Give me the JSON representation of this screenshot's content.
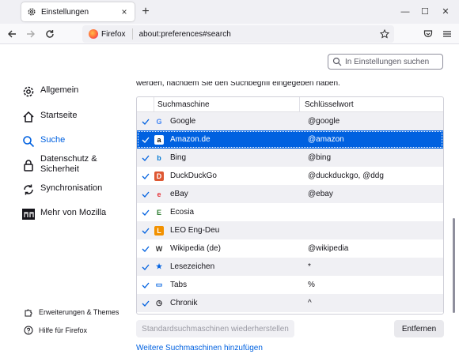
{
  "tab": {
    "title": "Einstellungen",
    "close": "×"
  },
  "newtab": "+",
  "window": {
    "minimize": "—",
    "maximize": "☐",
    "close": "✕"
  },
  "urlbar": {
    "identity": "Firefox",
    "url": "about:preferences#search"
  },
  "search": {
    "placeholder": "In Einstellungen suchen"
  },
  "sidebar": {
    "items": [
      {
        "label": "Allgemein",
        "icon": "gear-icon"
      },
      {
        "label": "Startseite",
        "icon": "home-icon"
      },
      {
        "label": "Suche",
        "icon": "search-icon",
        "selected": true
      },
      {
        "label": "Datenschutz & Sicherheit",
        "icon": "lock-icon"
      },
      {
        "label": "Synchronisation",
        "icon": "sync-icon"
      },
      {
        "label": "Mehr von Mozilla",
        "icon": "mozilla-icon"
      }
    ],
    "footer": [
      {
        "label": "Erweiterungen & Themes",
        "icon": "puzzle-icon"
      },
      {
        "label": "Hilfe für Firefox",
        "icon": "help-icon"
      }
    ]
  },
  "main": {
    "intro": "werden, nachdem Sie den Suchbegriff eingegeben haben.",
    "columns": {
      "engine": "Suchmaschine",
      "keyword": "Schlüsselwort"
    },
    "engines": [
      {
        "name": "Google",
        "keyword": "@google",
        "icon": "google-icon",
        "glyph": "G",
        "color": "#4285f4",
        "bg": "transparent"
      },
      {
        "name": "Amazon.de",
        "keyword": "@amazon",
        "icon": "amazon-icon",
        "glyph": "a",
        "color": "#000000",
        "bg": "#ffffff"
      },
      {
        "name": "Bing",
        "keyword": "@bing",
        "icon": "bing-icon",
        "glyph": "b",
        "color": "#0078d4",
        "bg": "transparent"
      },
      {
        "name": "DuckDuckGo",
        "keyword": "@duckduckgo, @ddg",
        "icon": "duckduckgo-icon",
        "glyph": "D",
        "color": "#ffffff",
        "bg": "#de5833"
      },
      {
        "name": "eBay",
        "keyword": "@ebay",
        "icon": "ebay-icon",
        "glyph": "e",
        "color": "#e53238",
        "bg": "transparent"
      },
      {
        "name": "Ecosia",
        "keyword": "",
        "icon": "ecosia-icon",
        "glyph": "E",
        "color": "#2e7d32",
        "bg": "transparent"
      },
      {
        "name": "LEO Eng-Deu",
        "keyword": "",
        "icon": "leo-icon",
        "glyph": "L",
        "color": "#ffffff",
        "bg": "#f29100"
      },
      {
        "name": "Wikipedia (de)",
        "keyword": "@wikipedia",
        "icon": "wikipedia-icon",
        "glyph": "W",
        "color": "#333333",
        "bg": "transparent"
      },
      {
        "name": "Lesezeichen",
        "keyword": "*",
        "icon": "star-icon",
        "glyph": "★",
        "color": "#0061e0",
        "bg": "transparent"
      },
      {
        "name": "Tabs",
        "keyword": "%",
        "icon": "tabs-icon",
        "glyph": "▭",
        "color": "#0061e0",
        "bg": "transparent"
      },
      {
        "name": "Chronik",
        "keyword": "^",
        "icon": "history-icon",
        "glyph": "◷",
        "color": "#15141a",
        "bg": "transparent"
      }
    ],
    "selected_index": 1,
    "restore_button": "Standardsuchmaschinen wiederherstellen",
    "remove_button": "Entfernen",
    "more_link": "Weitere Suchmaschinen hinzufügen"
  }
}
